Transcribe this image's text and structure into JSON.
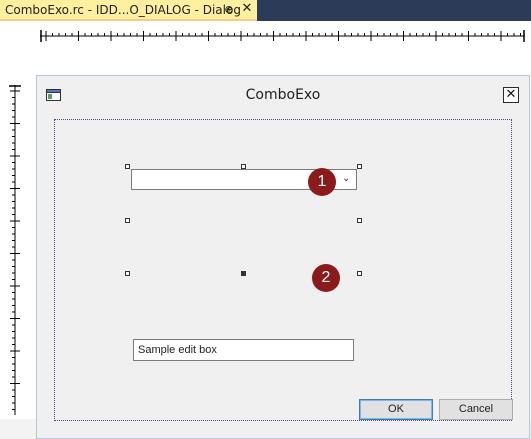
{
  "tab": {
    "title": "ComboExo.rc - IDD...O_DIALOG - Dialog",
    "pin_glyph": "⊕",
    "close_glyph": "✕"
  },
  "dialog": {
    "title": "ComboExo",
    "close_glyph": "✕",
    "combo_arrow_glyph": "⌄",
    "edit_text": "Sample edit box",
    "ok_label": "OK",
    "cancel_label": "Cancel"
  },
  "callouts": [
    "1",
    "2"
  ],
  "colors": {
    "tab_active": "#fff0a0",
    "tabstrip": "#2b3b58",
    "callout": "#8b1a1a",
    "dialog_bg": "#f0f0f0"
  }
}
